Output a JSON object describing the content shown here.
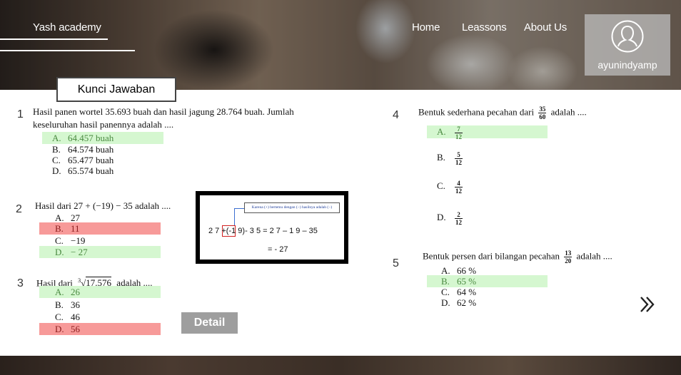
{
  "header": {
    "brand": "Yash academy",
    "nav": [
      "Home",
      "Leassons",
      "About Us"
    ],
    "user": {
      "name": "ayunindyamp",
      "icon": "user-avatar-icon"
    }
  },
  "section_title": "Kunci Jawaban",
  "questions": [
    {
      "number": "1",
      "text_line1": "Hasil panen wortel 35.693 buah dan hasil jagung 28.764 buah. Jumlah",
      "text_line2": "keseluruhan hasil panennya adalah ....",
      "options": [
        {
          "letter": "A.",
          "text": "64.457 buah",
          "status": "correct"
        },
        {
          "letter": "B.",
          "text": "64.574 buah",
          "status": "none"
        },
        {
          "letter": "C.",
          "text": "65.477 buah",
          "status": "none"
        },
        {
          "letter": "D.",
          "text": "65.574 buah",
          "status": "none"
        }
      ]
    },
    {
      "number": "2",
      "text": "Hasil dari 27 + (−19) − 35 adalah ....",
      "options": [
        {
          "letter": "A.",
          "text": "27",
          "status": "none"
        },
        {
          "letter": "B.",
          "text": "11",
          "status": "wrong"
        },
        {
          "letter": "C.",
          "text": "−19",
          "status": "none"
        },
        {
          "letter": "D.",
          "text": "− 27",
          "status": "correct"
        }
      ]
    },
    {
      "number": "3",
      "text_prefix": "Hasil dari",
      "text_root_index": "3",
      "text_root_value": "17.576",
      "text_suffix": "adalah ....",
      "options": [
        {
          "letter": "A.",
          "text": "26",
          "status": "correct"
        },
        {
          "letter": "B.",
          "text": "36",
          "status": "none"
        },
        {
          "letter": "C.",
          "text": "46",
          "status": "none"
        },
        {
          "letter": "D.",
          "text": "56",
          "status": "wrong"
        }
      ]
    },
    {
      "number": "4",
      "text_prefix": "Bentuk sederhana pecahan dari",
      "frac_num": "35",
      "frac_den": "60",
      "text_suffix": "adalah ....",
      "options": [
        {
          "letter": "A.",
          "num": "7",
          "den": "12",
          "status": "correct"
        },
        {
          "letter": "B.",
          "num": "5",
          "den": "12",
          "status": "none"
        },
        {
          "letter": "C.",
          "num": "4",
          "den": "12",
          "status": "none"
        },
        {
          "letter": "D.",
          "num": "2",
          "den": "12",
          "status": "none"
        }
      ]
    },
    {
      "number": "5",
      "text_prefix": "Bentuk persen dari bilangan pecahan",
      "frac_num": "13",
      "frac_den": "20",
      "text_suffix": "adalah ....",
      "options": [
        {
          "letter": "A.",
          "text": "66 %",
          "status": "none"
        },
        {
          "letter": "B.",
          "text": "65 %",
          "status": "correct"
        },
        {
          "letter": "C.",
          "text": "64 %",
          "status": "none"
        },
        {
          "letter": "D.",
          "text": "62 %",
          "status": "none"
        }
      ]
    }
  ],
  "explanation": {
    "note": "Karena (+) bertemu dengan (−) hasilnya adalah (−)",
    "step1_part1": "2 7",
    "step1_boxed": "+(-",
    "step1_part2": "1 9)- 3 5 = 2 7 – 1 9 – 35",
    "step2": "= - 27"
  },
  "detail_button": "Detail",
  "next_icon": "double-chevron-right-icon",
  "colors": {
    "correct_bg": "#d5f7d0",
    "wrong_bg": "#f79a99",
    "button_bg": "#9e9e9e"
  }
}
